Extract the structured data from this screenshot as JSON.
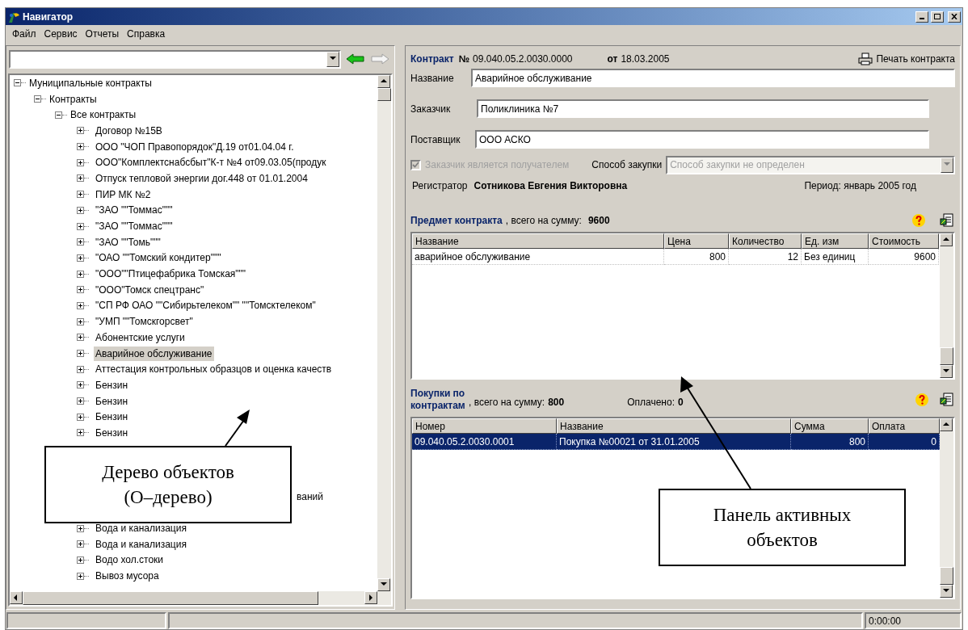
{
  "window": {
    "title": "Навигатор"
  },
  "menu": [
    "Файл",
    "Сервис",
    "Отчеты",
    "Справка"
  ],
  "tree": {
    "label": "Муниципальные контракты",
    "expanded": true,
    "selected": false,
    "children": [
      {
        "label": "Контракты",
        "expanded": true,
        "selected": false,
        "children": [
          {
            "label": "Все контракты",
            "expanded": true,
            "selected": false,
            "children": [
              {
                "label": "Договор №15В",
                "expanded": false,
                "selected": false
              },
              {
                "label": "ООО \"ЧОП Правопорядок\"Д.19 от01.04.04 г.",
                "expanded": false,
                "selected": false
              },
              {
                "label": "ООО\"Комплектснабсбыт\"К-т №4 от09.03.05(продук",
                "expanded": false,
                "selected": false
              },
              {
                "label": "Отпуск тепловой энергии  дог.448 от 01.01.2004",
                "expanded": false,
                "selected": false
              },
              {
                "label": "ПИР МК №2",
                "expanded": false,
                "selected": false
              },
              {
                "label": "\"ЗАО \"\"Томмас\"\"\"",
                "expanded": false,
                "selected": false
              },
              {
                "label": "\"ЗАО \"\"Томмас\"\"\"",
                "expanded": false,
                "selected": false
              },
              {
                "label": "\"ЗАО \"\"Томь\"\"\"",
                "expanded": false,
                "selected": false
              },
              {
                "label": "\"ОАО \"\"Томский кондитер\"\"\"",
                "expanded": false,
                "selected": false
              },
              {
                "label": "\"ООО\"\"Птицефабрика Томская\"\"\"",
                "expanded": false,
                "selected": false
              },
              {
                "label": "\"ООО\"Томск спецтранс\"",
                "expanded": false,
                "selected": false
              },
              {
                "label": "\"СП РФ ОАО \"\"Сибирьтелеком\"\" \"\"Томсктелеком\"",
                "expanded": false,
                "selected": false
              },
              {
                "label": "\"УМП \"\"Томскгорсвет\"",
                "expanded": false,
                "selected": false
              },
              {
                "label": "Абонентские услуги",
                "expanded": false,
                "selected": false
              },
              {
                "label": "Аварийное обслуживание",
                "expanded": false,
                "selected": true
              },
              {
                "label": "Аттестация контрольных образцов и оценка качеств",
                "expanded": false,
                "selected": false
              },
              {
                "label": "Бензин",
                "expanded": false,
                "selected": false
              },
              {
                "label": "Бензин",
                "expanded": false,
                "selected": false
              },
              {
                "label": "Бензин",
                "expanded": false,
                "selected": false
              },
              {
                "label": "Бензин",
                "expanded": false,
                "selected": false
              },
              {
                "label": "ваний",
                "kind": "partial"
              },
              {
                "label": "Вода и канализация",
                "expanded": false,
                "selected": false
              },
              {
                "label": "Вода и канализация",
                "expanded": false,
                "selected": false
              },
              {
                "label": "Водо хол.стоки",
                "expanded": false,
                "selected": false
              },
              {
                "label": "Вывоз мусора",
                "expanded": false,
                "selected": false
              }
            ]
          }
        ]
      }
    ]
  },
  "contract": {
    "title": "Контракт",
    "number_label": "№",
    "number": "09.040.05.2.0030.0000",
    "date_label": "от",
    "date": "18.03.2005",
    "print": "Печать контракта",
    "fields": [
      {
        "label": "Название",
        "value": "Аварийное обслуживание"
      },
      {
        "label": "Заказчик",
        "value": "Поликлиника №7"
      },
      {
        "label": "Поставщик",
        "value": "ООО АСКО"
      }
    ],
    "recipient": {
      "label": "Заказчик является получателем",
      "checked": true,
      "disabled": true
    },
    "procurement": {
      "label": "Способ закупки",
      "value": "Способ  закупки не определен",
      "disabled": true
    },
    "registrar_label": "Регистратор",
    "registrar": "Сотникова Евгения Викторовна",
    "period": "Период:  январь 2005 год"
  },
  "subject": {
    "title": "Предмет контракта",
    "sum_label": ", всего  на сумму:",
    "sum": "9600",
    "columns": [
      "Название",
      "Цена",
      "Количество",
      "Ед. изм",
      "Стоимость"
    ],
    "rows": [
      {
        "cells": [
          "аварийное обслуживание",
          "800",
          "12",
          "Без единиц",
          "9600"
        ],
        "selected": false
      }
    ]
  },
  "purchases": {
    "title": "Покупки по контрактам",
    "sum_label": ", всего  на сумму:",
    "sum": "800",
    "paid_label": "Оплачено:",
    "paid": "0",
    "columns": [
      "Номер",
      "Название",
      "Сумма",
      "Оплата"
    ],
    "rows": [
      {
        "cells": [
          "09.040.05.2.0030.0001",
          "Покупка №00021 от 31.01.2005",
          "800",
          "0"
        ],
        "selected": true
      }
    ]
  },
  "callouts": [
    "Дерево объектов (О–дерево)",
    "Панель активных объектов"
  ],
  "status_bar": {
    "time": "0:00:00"
  }
}
